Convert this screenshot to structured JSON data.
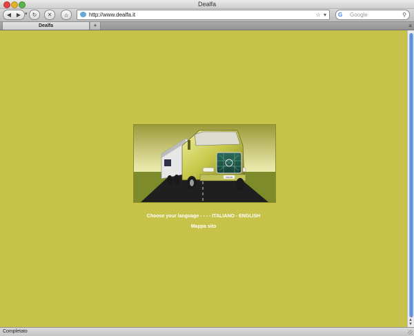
{
  "window": {
    "title": "Dealfa"
  },
  "toolbar": {
    "back_symbol": "◀",
    "forward_symbol": "▶",
    "reload_symbol": "↻",
    "stop_symbol": "✕",
    "home_symbol": "⌂",
    "url": "http://www.dealfa.it",
    "url_actions": "☆ ▾",
    "search_placeholder": "Google",
    "search_engine_glyph": "G",
    "search_icon": "⚲"
  },
  "tabs": [
    {
      "label": "Dealfa"
    }
  ],
  "tab_add_label": "+",
  "tab_menu_label": "≡",
  "content": {
    "background": "#c6c24a",
    "choose_prefix": "Choose your language - - - - ",
    "lang_italiano": "ITALIANO",
    "lang_sep": " - ",
    "lang_english": "ENGLISH",
    "sitemap": "Mappa sito",
    "truck_plate": "VOLVO"
  },
  "status": {
    "text": "Completato"
  },
  "colors": {
    "accent": "#4a86d4",
    "page_bg": "#c6c24a",
    "text": "#ffffff"
  }
}
